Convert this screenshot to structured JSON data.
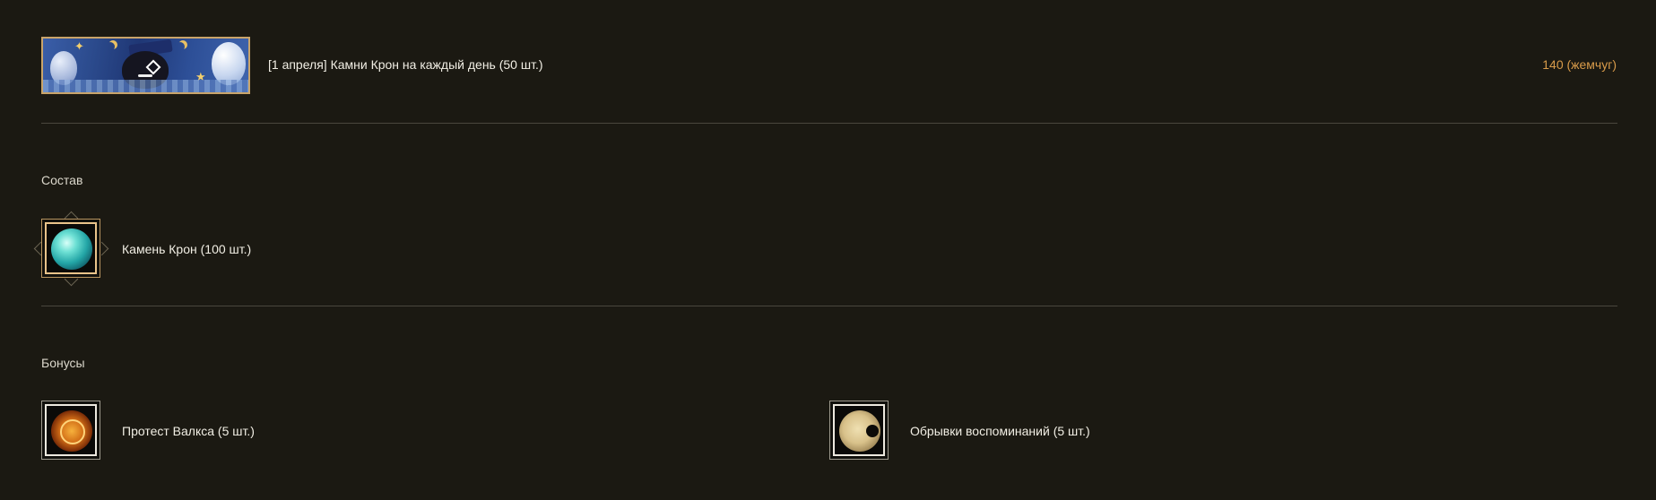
{
  "offer": {
    "title": "[1 апреля] Камни Крон на каждый день (50 шт.)",
    "price": "140 (жемчуг)"
  },
  "composition": {
    "heading": "Состав",
    "items": [
      {
        "label": "Камень Крон (100 шт.)",
        "icon": "kron-stone-orb-icon"
      }
    ]
  },
  "bonuses": {
    "heading": "Бонусы",
    "items": [
      {
        "label": "Протест Валкса (5 шт.)",
        "icon": "valks-protest-medal-icon"
      },
      {
        "label": "Обрывки воспоминаний (5 шт.)",
        "icon": "memory-fragments-icon"
      }
    ]
  },
  "colors": {
    "background": "#1b1912",
    "price": "#d89b4a",
    "divider": "#4a473e"
  }
}
